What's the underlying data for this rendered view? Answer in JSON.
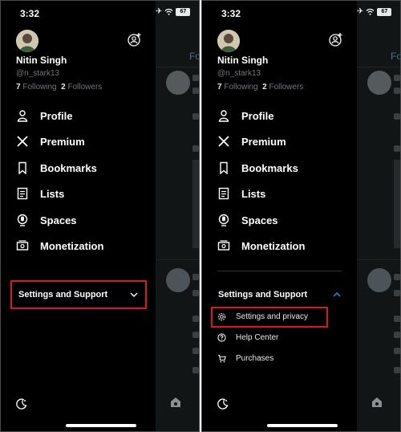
{
  "status": {
    "time": "3:32",
    "battery": "67"
  },
  "profile": {
    "name": "Nitin Singh",
    "handle": "@n_stark13",
    "following_count": "7",
    "following_label": "Following",
    "followers_count": "2",
    "followers_label": "Followers"
  },
  "menu": {
    "items": [
      {
        "label": "Profile",
        "icon": "person-icon"
      },
      {
        "label": "Premium",
        "icon": "x-logo-icon"
      },
      {
        "label": "Bookmarks",
        "icon": "bookmark-icon"
      },
      {
        "label": "Lists",
        "icon": "list-icon"
      },
      {
        "label": "Spaces",
        "icon": "microphone-icon"
      },
      {
        "label": "Monetization",
        "icon": "money-icon"
      }
    ],
    "settings_support": "Settings and Support",
    "subitems": [
      {
        "label": "Settings and privacy",
        "icon": "gear-icon"
      },
      {
        "label": "Help Center",
        "icon": "help-circle-icon"
      },
      {
        "label": "Purchases",
        "icon": "cart-icon"
      }
    ]
  },
  "background": {
    "tab_fragment": "For"
  },
  "colors": {
    "highlight": "#d9191e",
    "link": "#1d9bf0",
    "background": "#000000"
  }
}
